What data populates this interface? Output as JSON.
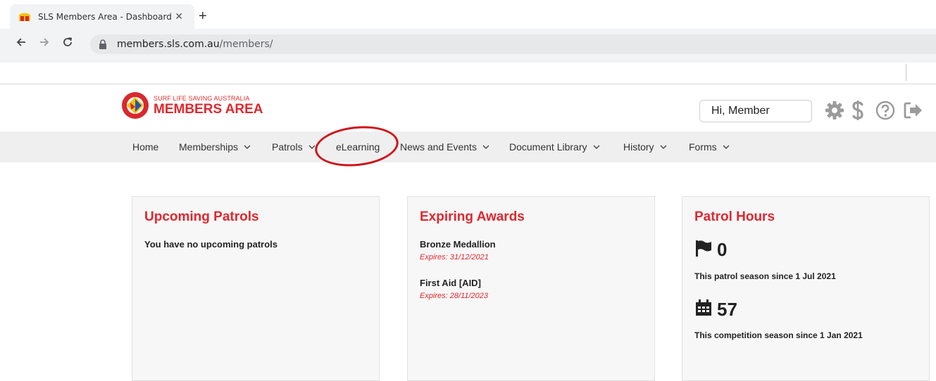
{
  "browser": {
    "tab_title": "SLS Members Area - Dashboard",
    "tab_close": "✕",
    "new_tab": "+",
    "url_host": "members.sls.com.au",
    "url_path": "/members/"
  },
  "header": {
    "logo_small": "SURF LIFE SAVING AUSTRALIA",
    "logo_big": "MEMBERS AREA",
    "greeting": "Hi, Member",
    "icons": [
      "gear-icon",
      "dollar-icon",
      "help-icon",
      "logout-icon"
    ]
  },
  "nav": {
    "items": [
      {
        "label": "Home",
        "dropdown": false
      },
      {
        "label": "Memberships",
        "dropdown": true
      },
      {
        "label": "Patrols",
        "dropdown": true
      },
      {
        "label": "eLearning",
        "dropdown": false
      },
      {
        "label": "News and Events",
        "dropdown": true
      },
      {
        "label": "Document Library",
        "dropdown": true
      },
      {
        "label": "History",
        "dropdown": true
      },
      {
        "label": "Forms",
        "dropdown": true
      }
    ]
  },
  "cards": {
    "patrols": {
      "title": "Upcoming Patrols",
      "message": "You have no upcoming patrols"
    },
    "awards": {
      "title": "Expiring Awards",
      "items": [
        {
          "name": "Bronze Medallion",
          "expires": "Expires: 31/12/2021"
        },
        {
          "name": "First Aid [AID]",
          "expires": "Expires: 28/11/2023"
        }
      ]
    },
    "hours": {
      "title": "Patrol Hours",
      "patrol_value": "0",
      "patrol_caption": "This patrol season since 1 Jul 2021",
      "competition_value": "57",
      "competition_caption": "This competition season since 1 Jan 2021"
    }
  },
  "colors": {
    "brand_red": "#e0282e",
    "annotation_red": "#d0141a",
    "navbar_bg": "#efefef",
    "card_bg": "#f7f7f7"
  }
}
